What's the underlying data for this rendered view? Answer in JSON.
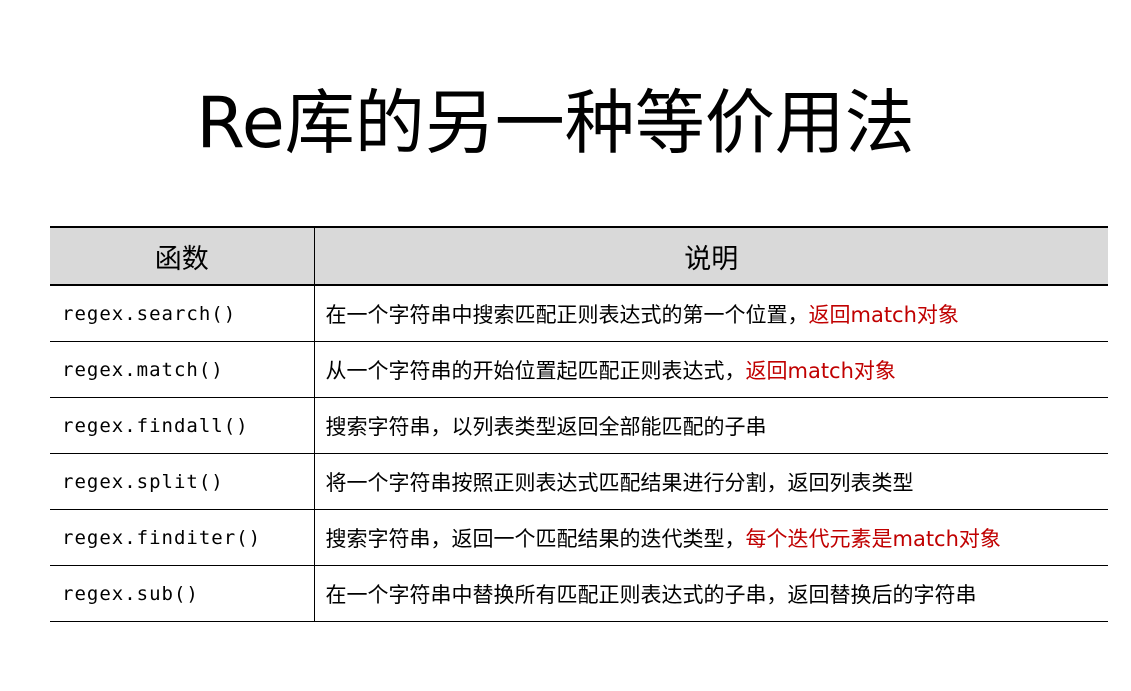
{
  "title": "Re库的另一种等价用法",
  "table": {
    "headers": [
      "函数",
      "说明"
    ],
    "rows": [
      {
        "fn": "regex.search()",
        "desc": "在一个字符串中搜索匹配正则表达式的第一个位置，",
        "desc_red": "返回match对象"
      },
      {
        "fn": "regex.match()",
        "desc": "从一个字符串的开始位置起匹配正则表达式，",
        "desc_red": "返回match对象"
      },
      {
        "fn": "regex.findall()",
        "desc": "搜索字符串，以列表类型返回全部能匹配的子串",
        "desc_red": ""
      },
      {
        "fn": "regex.split()",
        "desc": "将一个字符串按照正则表达式匹配结果进行分割，返回列表类型",
        "desc_red": ""
      },
      {
        "fn": "regex.finditer()",
        "desc": "搜索字符串，返回一个匹配结果的迭代类型，",
        "desc_red": "每个迭代元素是match对象"
      },
      {
        "fn": "regex.sub()",
        "desc": "在一个字符串中替换所有匹配正则表达式的子串，返回替换后的字符串",
        "desc_red": ""
      }
    ]
  },
  "colors": {
    "highlight": "#c00000",
    "header_bg": "#d9d9d9"
  }
}
